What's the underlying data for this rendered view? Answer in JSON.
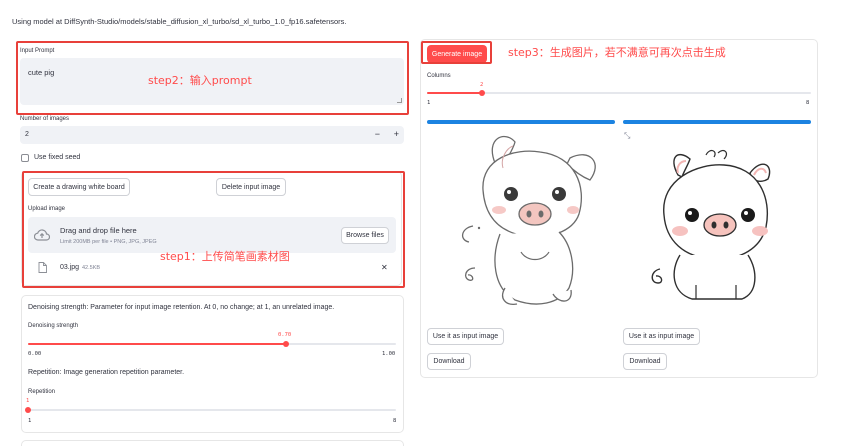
{
  "status_line": "Using model at DiffSynth-Studio/models/stable_diffusion_xl_turbo/sd_xl_turbo_1.0_fp16.safetensors.",
  "prompt": {
    "label": "Input Prompt",
    "value": "cute pig"
  },
  "num_images": {
    "label": "Number of images",
    "value": "2",
    "minus": "−",
    "plus": "+"
  },
  "seed": {
    "label": "Use fixed seed",
    "checked": false
  },
  "board": {
    "create_label": "Create a drawing white board",
    "delete_label": "Delete input image",
    "upload_label": "Upload image",
    "drop_title": "Drag and drop file here",
    "drop_hint": "Limit 200MB per file • PNG, JPG, JPEG",
    "browse_label": "Browse files",
    "file_name": "03.jpg",
    "file_size": "42.5KB",
    "remove_glyph": "✕"
  },
  "denoise": {
    "description": "Denoising strength: Parameter for input image retention. At 0, no change; at 1, an unrelated image.",
    "slider_label": "Denoising strength",
    "value_text": "0.70",
    "value": 0.7,
    "min_text": "0.00",
    "max_text": "1.00"
  },
  "repetition": {
    "description": "Repetition: Image generation repetition parameter.",
    "slider_label": "Repetition",
    "value_text": "1",
    "value": 1,
    "min": 1,
    "max": 8,
    "min_text": "1",
    "max_text": "8"
  },
  "right": {
    "generate_label": "Generate image",
    "columns_label": "Columns",
    "columns_value_text": "2",
    "columns_value": 2,
    "columns_min": 1,
    "columns_max": 8,
    "columns_min_text": "1",
    "columns_max_text": "8",
    "use_input_label": "Use it as input image",
    "download_label": "Download",
    "expand_glyph": "⤡"
  },
  "annotations": {
    "step1": "step1：上传简笔画素材图",
    "step2": "step2：输入prompt",
    "step3": "step3：生成图片，若不满意可再次点击生成"
  },
  "colors": {
    "accent": "#ff4b4b",
    "annotation_box": "#e8403a",
    "tab": "#1c83e1",
    "input_bg": "#f0f2f6"
  },
  "icons": [
    "cloud-upload-icon",
    "file-icon",
    "close-icon",
    "expand-icon"
  ]
}
